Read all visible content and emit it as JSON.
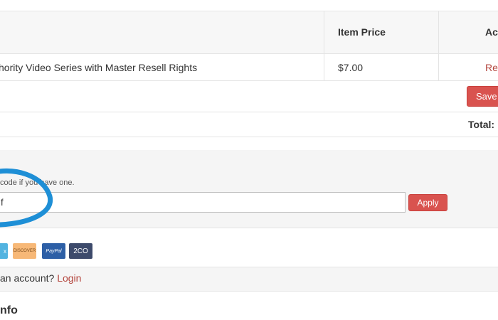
{
  "cart_table": {
    "headers": {
      "item_price": "Item Price",
      "actions": "Ac"
    },
    "rows": [
      {
        "product": "hority Video Series with Master Resell Rights",
        "price": "$7.00",
        "action": "Re"
      }
    ],
    "save_button": "Save",
    "total_label": "Total:"
  },
  "promo": {
    "hint": "code if you have one.",
    "input_value": "f",
    "apply_button": "Apply"
  },
  "payment_methods": [
    "x",
    "DISCOVER",
    "PayPal",
    "2CO"
  ],
  "account": {
    "prompt": "an account?",
    "login_link": "Login"
  },
  "next_section_title": "nfo",
  "colors": {
    "accent_red": "#d9534f",
    "link_red": "#b3443c",
    "annotation_blue": "#1e8fd6"
  }
}
